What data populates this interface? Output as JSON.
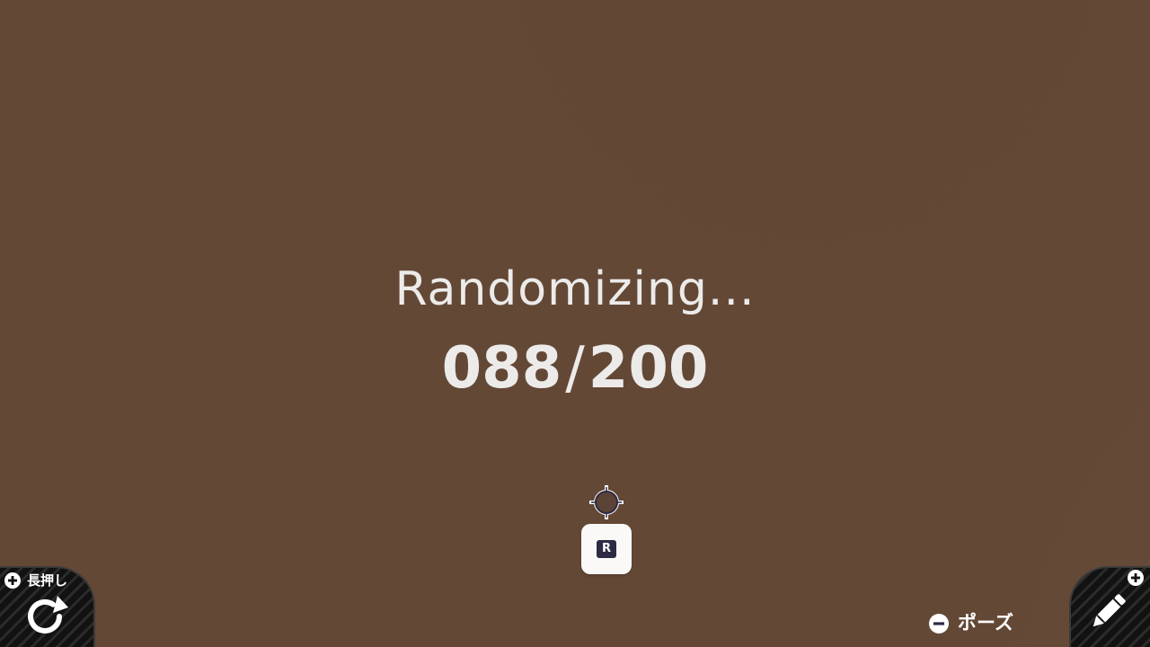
{
  "status": {
    "label": "Randomizing...",
    "current": "088",
    "separator": "/",
    "total": "200",
    "progress_fraction": 0.44
  },
  "cursor": {
    "icon": "crosshair-icon",
    "button_label": "R"
  },
  "bottom_left": {
    "plus_icon": "plus-circle-icon",
    "hold_label": "長押し",
    "action_icon": "refresh-icon"
  },
  "bottom_right": {
    "plus_icon": "plus-circle-icon",
    "action_icon": "pencil-icon"
  },
  "pause": {
    "icon": "minus-circle-icon",
    "label": "ポーズ"
  },
  "colors": {
    "background": "#644836",
    "text": "#ecebea",
    "corner_panel": "#121212",
    "key_badge": "#2d2a44"
  }
}
